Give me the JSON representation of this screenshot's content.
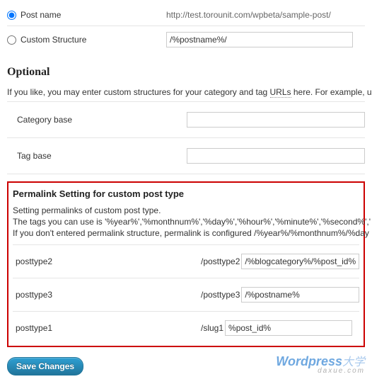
{
  "common": {
    "radio_post_name": "Post name",
    "sample_url": "http://test.torounit.com/wpbeta/sample-post/",
    "radio_custom": "Custom Structure",
    "custom_value": "/%postname%/"
  },
  "optional": {
    "heading": "Optional",
    "helper_pre": "If you like, you may enter custom structures for your category and tag ",
    "helper_link": "URLs",
    "helper_post": " here. For example, u",
    "category_label": "Category base",
    "category_value": "",
    "tag_label": "Tag base",
    "tag_value": ""
  },
  "cpt": {
    "heading": "Permalink Setting for custom post type",
    "desc1": "Setting permalinks of custom post type.",
    "desc2": "The tags you can use is '%year%','%monthnum%','%day%','%hour%','%minute%','%second%','",
    "desc3": "If you don't entered permalink structure, permalink is configured /%year%/%monthnum%/%day",
    "rows": [
      {
        "label": "posttype2",
        "prefix": "/posttype2",
        "value": "/%blogcategory%/%post_id%"
      },
      {
        "label": "posttype3",
        "prefix": "/posttype3",
        "value": "/%postname%"
      },
      {
        "label": "posttype1",
        "prefix": "/slug1",
        "value": "%post_id%"
      }
    ]
  },
  "actions": {
    "save": "Save Changes"
  },
  "watermark": {
    "main": "Wordpress",
    "accent": "大学",
    "sub": "daxue.com"
  }
}
